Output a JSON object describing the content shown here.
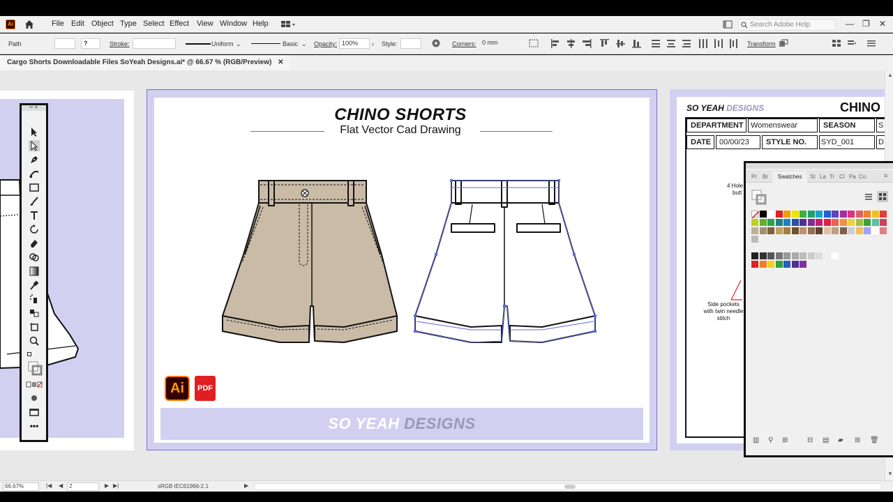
{
  "menubar": {
    "app_logo": "Ai",
    "items": [
      "File",
      "Edit",
      "Object",
      "Type",
      "Select",
      "Effect",
      "View",
      "Window",
      "Help"
    ],
    "search_placeholder": "Search Adobe Help"
  },
  "controlbar": {
    "selection_label": "Path",
    "stroke_label": "Stroke:",
    "stroke_weight": "?",
    "profile": "Uniform",
    "brush": "Basic",
    "opacity_label": "Opacity:",
    "opacity_value": "100%",
    "style_label": "Style:",
    "corners_label": "Corners:",
    "corners_value": "0 mm",
    "transform_label": "Transform"
  },
  "document": {
    "tab_title": "Cargo Shorts Downloadable Files SoYeah Designs.ai* @ 66.67 % (RGB/Preview)",
    "tab_close": "✕"
  },
  "artboard_main": {
    "title": "CHINO SHORTS",
    "subtitle": "Flat Vector Cad Drawing",
    "badge_ai": "Ai",
    "badge_pdf": "PDF",
    "brand_left": "SO YEAH",
    "brand_right": "DESIGNS"
  },
  "artboard_right": {
    "brand_left": "SO YEAH",
    "brand_right": "DESIGNS",
    "title": "CHINO",
    "department_label": "DEPARTMENT",
    "department_value": "Womenswear",
    "season_label": "SEASON",
    "season_value": "S",
    "date_label": "DATE",
    "date_value": "00/00/23",
    "style_label": "STYLE NO.",
    "style_value": "SYD_001",
    "extra_cell": "D",
    "note_top": "4 Hole",
    "note_top2": "butt",
    "note_side": "Side pockets",
    "note_side2": "with twin needle",
    "note_side3": "stitch"
  },
  "swatches_panel": {
    "tabs": [
      "Pr",
      "Br",
      "Swatches",
      "St",
      "La",
      "Tr",
      "Cl",
      "Pa",
      "Co"
    ],
    "active_tab": "Swatches"
  },
  "statusbar": {
    "zoom": "66.67%",
    "artboard_number": "2",
    "profile": "sRGB IEC61966-2.1"
  },
  "colors": {
    "accent_lilac": "#d2d0f1",
    "short_fill": "#c9bba6",
    "brand_gray": "#9a98b8"
  }
}
